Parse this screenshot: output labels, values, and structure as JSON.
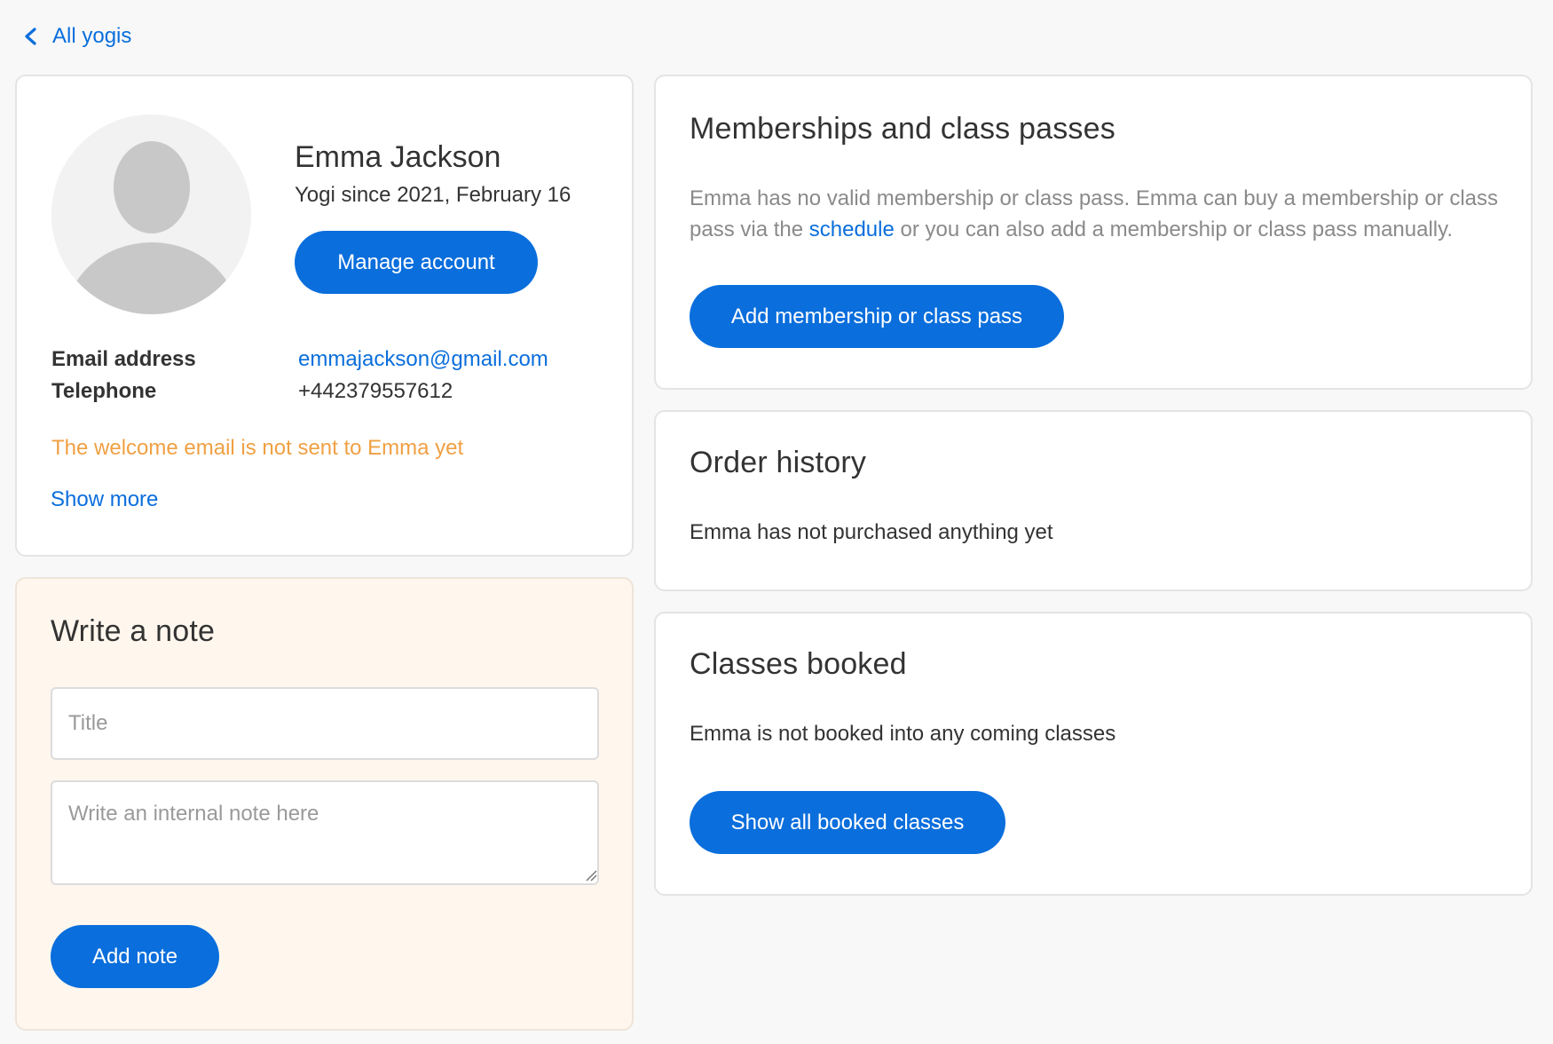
{
  "nav": {
    "back_label": "All yogis",
    "back_icon": "chevron-left-icon"
  },
  "profile": {
    "avatar_icon": "user-silhouette-icon",
    "name": "Emma Jackson",
    "since": "Yogi since 2021, February 16",
    "manage_label": "Manage account",
    "email_label": "Email address",
    "email_value": "emmajackson@gmail.com",
    "phone_label": "Telephone",
    "phone_value": "+442379557612",
    "welcome_warning": "The welcome email is not sent to Emma yet",
    "show_more_label": "Show more"
  },
  "note": {
    "title": "Write a note",
    "title_placeholder": "Title",
    "body_placeholder": "Write an internal note here",
    "add_label": "Add note"
  },
  "memberships": {
    "title": "Memberships and class passes",
    "desc_before": "Emma has no valid membership or class pass. Emma can buy a membership or class pass via the ",
    "desc_link": "schedule",
    "desc_after": " or you can also add a membership or class pass manually.",
    "add_label": "Add membership or class pass"
  },
  "orders": {
    "title": "Order history",
    "empty_text": "Emma has not purchased anything yet"
  },
  "classes": {
    "title": "Classes booked",
    "empty_text": "Emma is not booked into any coming classes",
    "show_all_label": "Show all booked classes"
  },
  "colors": {
    "accent": "#0a6edc",
    "warning": "#f0a043",
    "note_background": "#fff7ee",
    "page_background": "#f8f8f8"
  }
}
